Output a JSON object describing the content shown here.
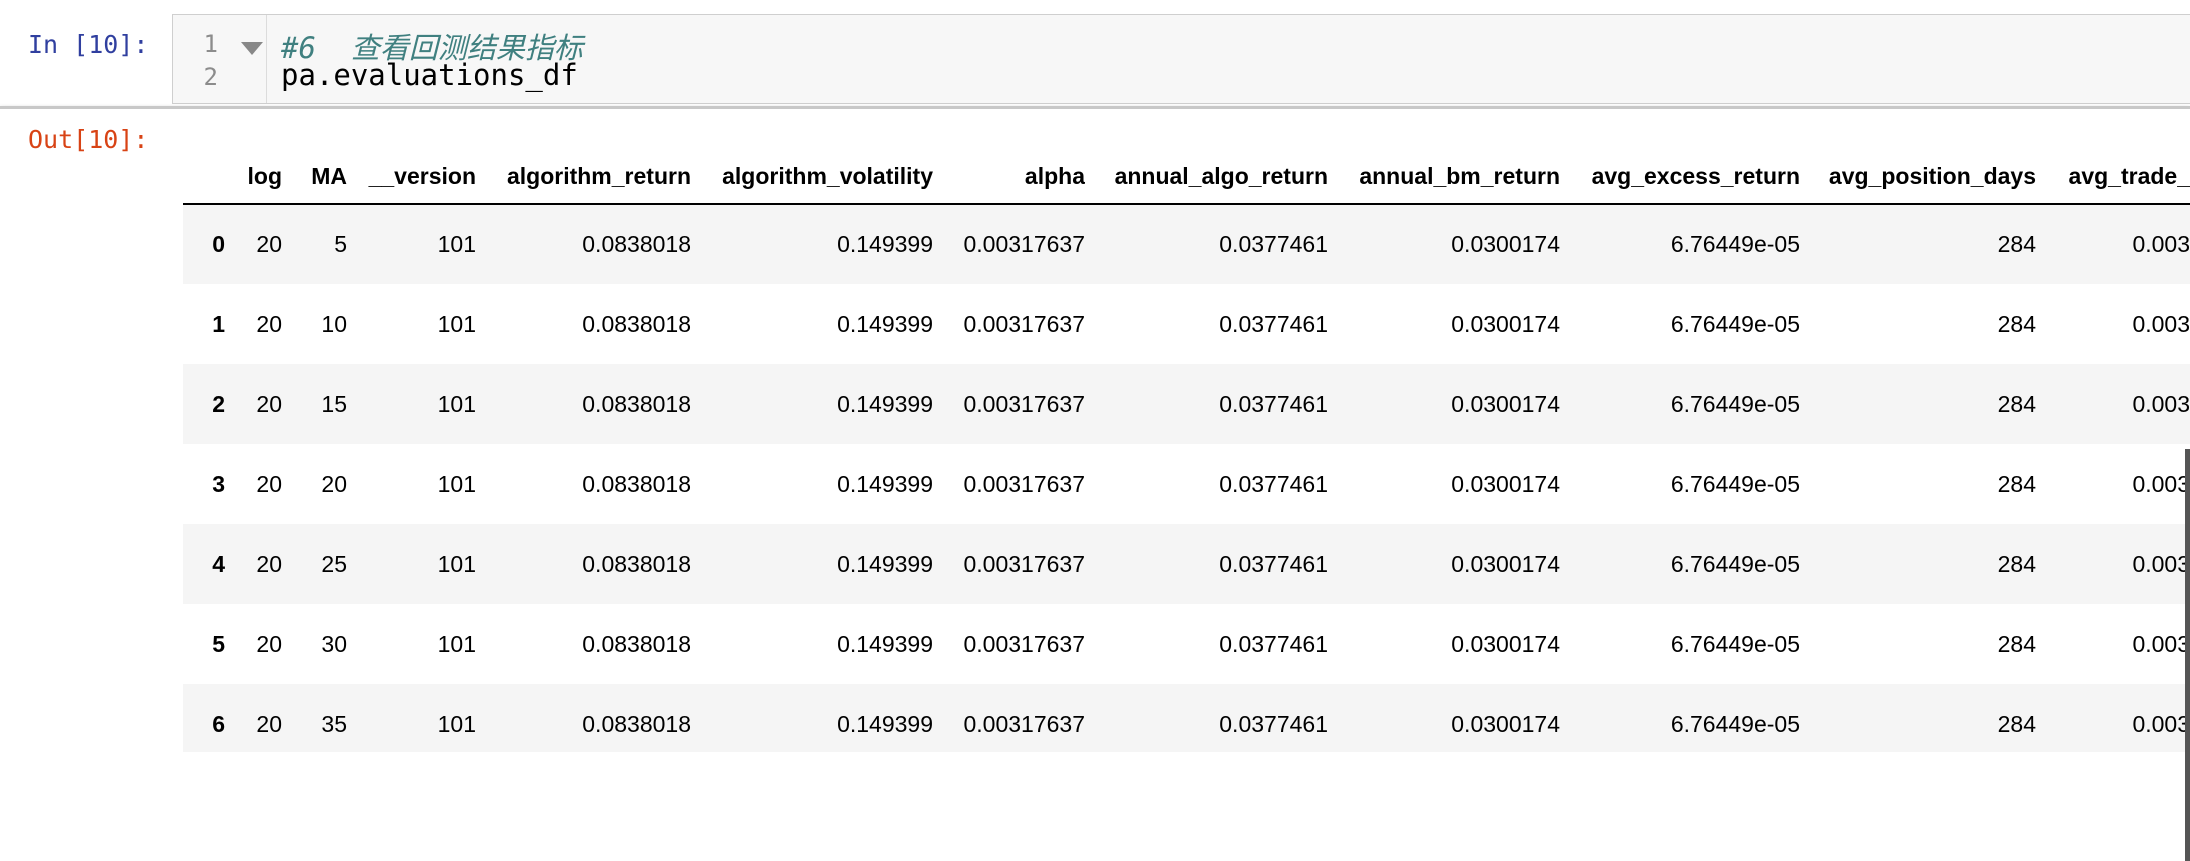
{
  "input_cell": {
    "prompt": "In [10]:",
    "lines": [
      {
        "number": "1",
        "text": "#6  查看回测结果指标"
      },
      {
        "number": "2",
        "text": "pa.evaluations_df"
      }
    ]
  },
  "output_cell": {
    "prompt": "Out[10]:"
  },
  "dataframe": {
    "columns": [
      "",
      "log",
      "MA",
      "__version",
      "algorithm_return",
      "algorithm_volatility",
      "alpha",
      "annual_algo_return",
      "annual_bm_return",
      "avg_excess_return",
      "avg_position_days",
      "avg_trade_"
    ],
    "rows": [
      [
        "0",
        "20",
        "5",
        "101",
        "0.0838018",
        "0.149399",
        "0.00317637",
        "0.0377461",
        "0.0300174",
        "6.76449e-05",
        "284",
        "0.003"
      ],
      [
        "1",
        "20",
        "10",
        "101",
        "0.0838018",
        "0.149399",
        "0.00317637",
        "0.0377461",
        "0.0300174",
        "6.76449e-05",
        "284",
        "0.003"
      ],
      [
        "2",
        "20",
        "15",
        "101",
        "0.0838018",
        "0.149399",
        "0.00317637",
        "0.0377461",
        "0.0300174",
        "6.76449e-05",
        "284",
        "0.003"
      ],
      [
        "3",
        "20",
        "20",
        "101",
        "0.0838018",
        "0.149399",
        "0.00317637",
        "0.0377461",
        "0.0300174",
        "6.76449e-05",
        "284",
        "0.003"
      ],
      [
        "4",
        "20",
        "25",
        "101",
        "0.0838018",
        "0.149399",
        "0.00317637",
        "0.0377461",
        "0.0300174",
        "6.76449e-05",
        "284",
        "0.003"
      ],
      [
        "5",
        "20",
        "30",
        "101",
        "0.0838018",
        "0.149399",
        "0.00317637",
        "0.0377461",
        "0.0300174",
        "6.76449e-05",
        "284",
        "0.003"
      ],
      [
        "6",
        "20",
        "35",
        "101",
        "0.0838018",
        "0.149399",
        "0.00317637",
        "0.0377461",
        "0.0300174",
        "6.76449e-05",
        "284",
        "0.003"
      ]
    ]
  },
  "colors": {
    "in_prompt": "#303f9f",
    "out_prompt": "#d84315",
    "comment": "#408080",
    "row_stripe": "#f5f5f5"
  }
}
